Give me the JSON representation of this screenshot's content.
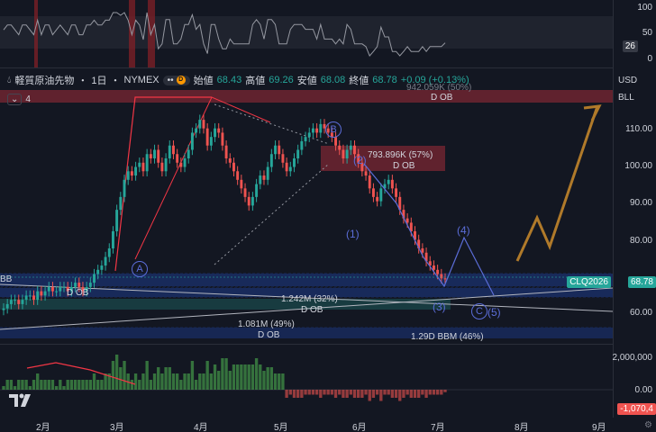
{
  "symbol": {
    "name": "軽質原油先物",
    "interval": "1日",
    "exchange": "NYMEX",
    "title_sep": "・",
    "badge": "D"
  },
  "ohlc": {
    "open_label": "始値",
    "open": "68.43",
    "high_label": "高値",
    "high": "69.26",
    "low_label": "安値",
    "low": "68.08",
    "close_label": "終値",
    "close": "68.78",
    "change": "+0.09 (+0.13%)"
  },
  "indicators_toggle": {
    "count": "4"
  },
  "price_axis": {
    "currency": "USD",
    "unit": "BLL",
    "ticks": [
      "110.00",
      "100.00",
      "90.00",
      "80.00",
      "70.00",
      "60.00"
    ],
    "current_symbol": "CLQ2026",
    "current_price": "68.78"
  },
  "rsi_axis": {
    "ticks": [
      "100",
      "50",
      "0"
    ],
    "value": "26"
  },
  "volume_axis": {
    "ticks": [
      "2,000,000",
      "0.00"
    ],
    "value": "-1,070,4"
  },
  "time_axis": {
    "labels": [
      "2月",
      "3月",
      "4月",
      "5月",
      "6月",
      "7月",
      "8月",
      "9月"
    ]
  },
  "annotations": {
    "ob_top": "942.059K (50%)",
    "ob_top_type": "D OB",
    "ob_mid": "793.896K (57%)",
    "ob_mid_type": "D OB",
    "ob_low1": "1.242M (32%)",
    "ob_low1_type": "D OB",
    "ob_low2": "1.081M (49%)",
    "ob_low2_type": "D OB",
    "ob_low3": "1.29",
    "ob_low3_tail": "M (46%)",
    "ob_low3_type": "D BB",
    "bb_left": "BB",
    "ob_left": "D OB"
  },
  "waves": {
    "A": "A",
    "B": "B",
    "C": "C",
    "w1": "(1)",
    "w2": "(2)",
    "w3": "(3)",
    "w4": "(4)",
    "w5": "(5)"
  },
  "colors": {
    "background": "#131722",
    "up": "#26a69a",
    "down": "#ef5350",
    "wave": "#5b6dd8",
    "projection": "#b07a2a",
    "ob_red": "#f2364580",
    "ob_blue": "#2962ff40"
  },
  "chart_data": {
    "type": "candlestick",
    "x_labels": [
      "2月",
      "3月",
      "4月",
      "5月",
      "6月",
      "7月",
      "8月",
      "9月"
    ],
    "ylim": [
      55,
      118
    ],
    "close_series": [
      62,
      63,
      64,
      64,
      63,
      64,
      65,
      65,
      64,
      66,
      65,
      66,
      67,
      66,
      66,
      67,
      67,
      66,
      67,
      68,
      67,
      66,
      67,
      68,
      70,
      71,
      72,
      74,
      76,
      80,
      85,
      88,
      92,
      94,
      93,
      95,
      96,
      94,
      98,
      97,
      99,
      96,
      94,
      97,
      100,
      98,
      96,
      95,
      97,
      99,
      103,
      104,
      106,
      104,
      100,
      102,
      104,
      103,
      100,
      97,
      96,
      94,
      92,
      90,
      88,
      86,
      88,
      91,
      93,
      92,
      95,
      98,
      100,
      98,
      96,
      94,
      95,
      97,
      99,
      101,
      102,
      103,
      104,
      103,
      105,
      104,
      103,
      102,
      100,
      99,
      97,
      99,
      100,
      98,
      96,
      94,
      93,
      90,
      88,
      87,
      90,
      91,
      92,
      90,
      88,
      85,
      83,
      82,
      80,
      78,
      76,
      75,
      73,
      72,
      71,
      70,
      69,
      68.78
    ],
    "rsi_last": 26,
    "volume_last": -1070.4
  }
}
